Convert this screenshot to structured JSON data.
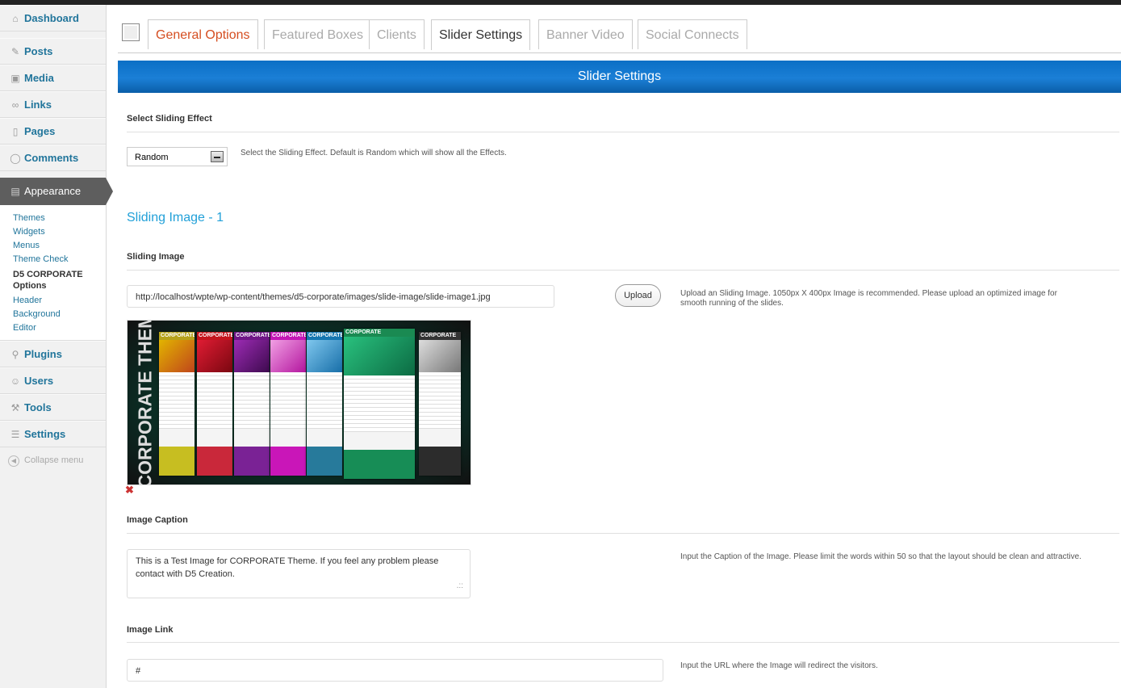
{
  "sidebar": {
    "items": [
      {
        "label": "Dashboard",
        "icon": "home-icon"
      },
      {
        "label": "Posts",
        "icon": "pin-icon"
      },
      {
        "label": "Media",
        "icon": "media-icon"
      },
      {
        "label": "Links",
        "icon": "link-icon"
      },
      {
        "label": "Pages",
        "icon": "pages-icon"
      },
      {
        "label": "Comments",
        "icon": "comments-icon"
      }
    ],
    "appearance": {
      "label": "Appearance",
      "icon": "appearance-icon"
    },
    "submenu": [
      "Themes",
      "Widgets",
      "Menus",
      "Theme Check",
      "D5 CORPORATE Options",
      "Header",
      "Background",
      "Editor"
    ],
    "items2": [
      {
        "label": "Plugins",
        "icon": "plugins-icon"
      },
      {
        "label": "Users",
        "icon": "users-icon"
      },
      {
        "label": "Tools",
        "icon": "tools-icon"
      },
      {
        "label": "Settings",
        "icon": "settings-icon"
      }
    ],
    "collapse": "Collapse menu"
  },
  "tabs": [
    "General Options",
    "Featured Boxes",
    "Clients",
    "Slider Settings",
    "Banner Video",
    "Social Connects"
  ],
  "banner": "Slider Settings",
  "effect": {
    "label": "Select Sliding Effect",
    "value": "Random",
    "help": "Select the Sliding Effect. Default is Random which will show all the Effects."
  },
  "slide": {
    "title": "Sliding Image - 1",
    "image_label": "Sliding Image",
    "image_url": "http://localhost/wpte/wp-content/themes/d5-corporate/images/slide-image/slide-image1.jpg",
    "upload": "Upload",
    "upload_help": "Upload an Sliding Image. 1050px X 400px Image is recommended. Please upload an optimized image for smooth running of the slides.",
    "thumb_vertical": "CORPORATE THEME",
    "thumb_pages": [
      "CORPORATE",
      "CORPORATE",
      "CORPORATE",
      "CORPORATE",
      "CORPORATE",
      "CORPORATE",
      "CORPORATE"
    ],
    "remove_icon": "✖",
    "caption_label": "Image Caption",
    "caption_value": "This is a Test Image for CORPORATE Theme. If you feel any problem please contact with D5 Creation.",
    "caption_help": "Input the Caption of the Image. Please limit the words within 50 so that the layout should be clean and attractive.",
    "link_label": "Image Link",
    "link_value": "#",
    "link_help": "Input the URL where the Image will redirect the visitors."
  },
  "colors": {
    "accent": "#21759b",
    "banner": "#1b7fd6",
    "tab_red": "#d54e21",
    "section_title": "#21a0d8"
  }
}
